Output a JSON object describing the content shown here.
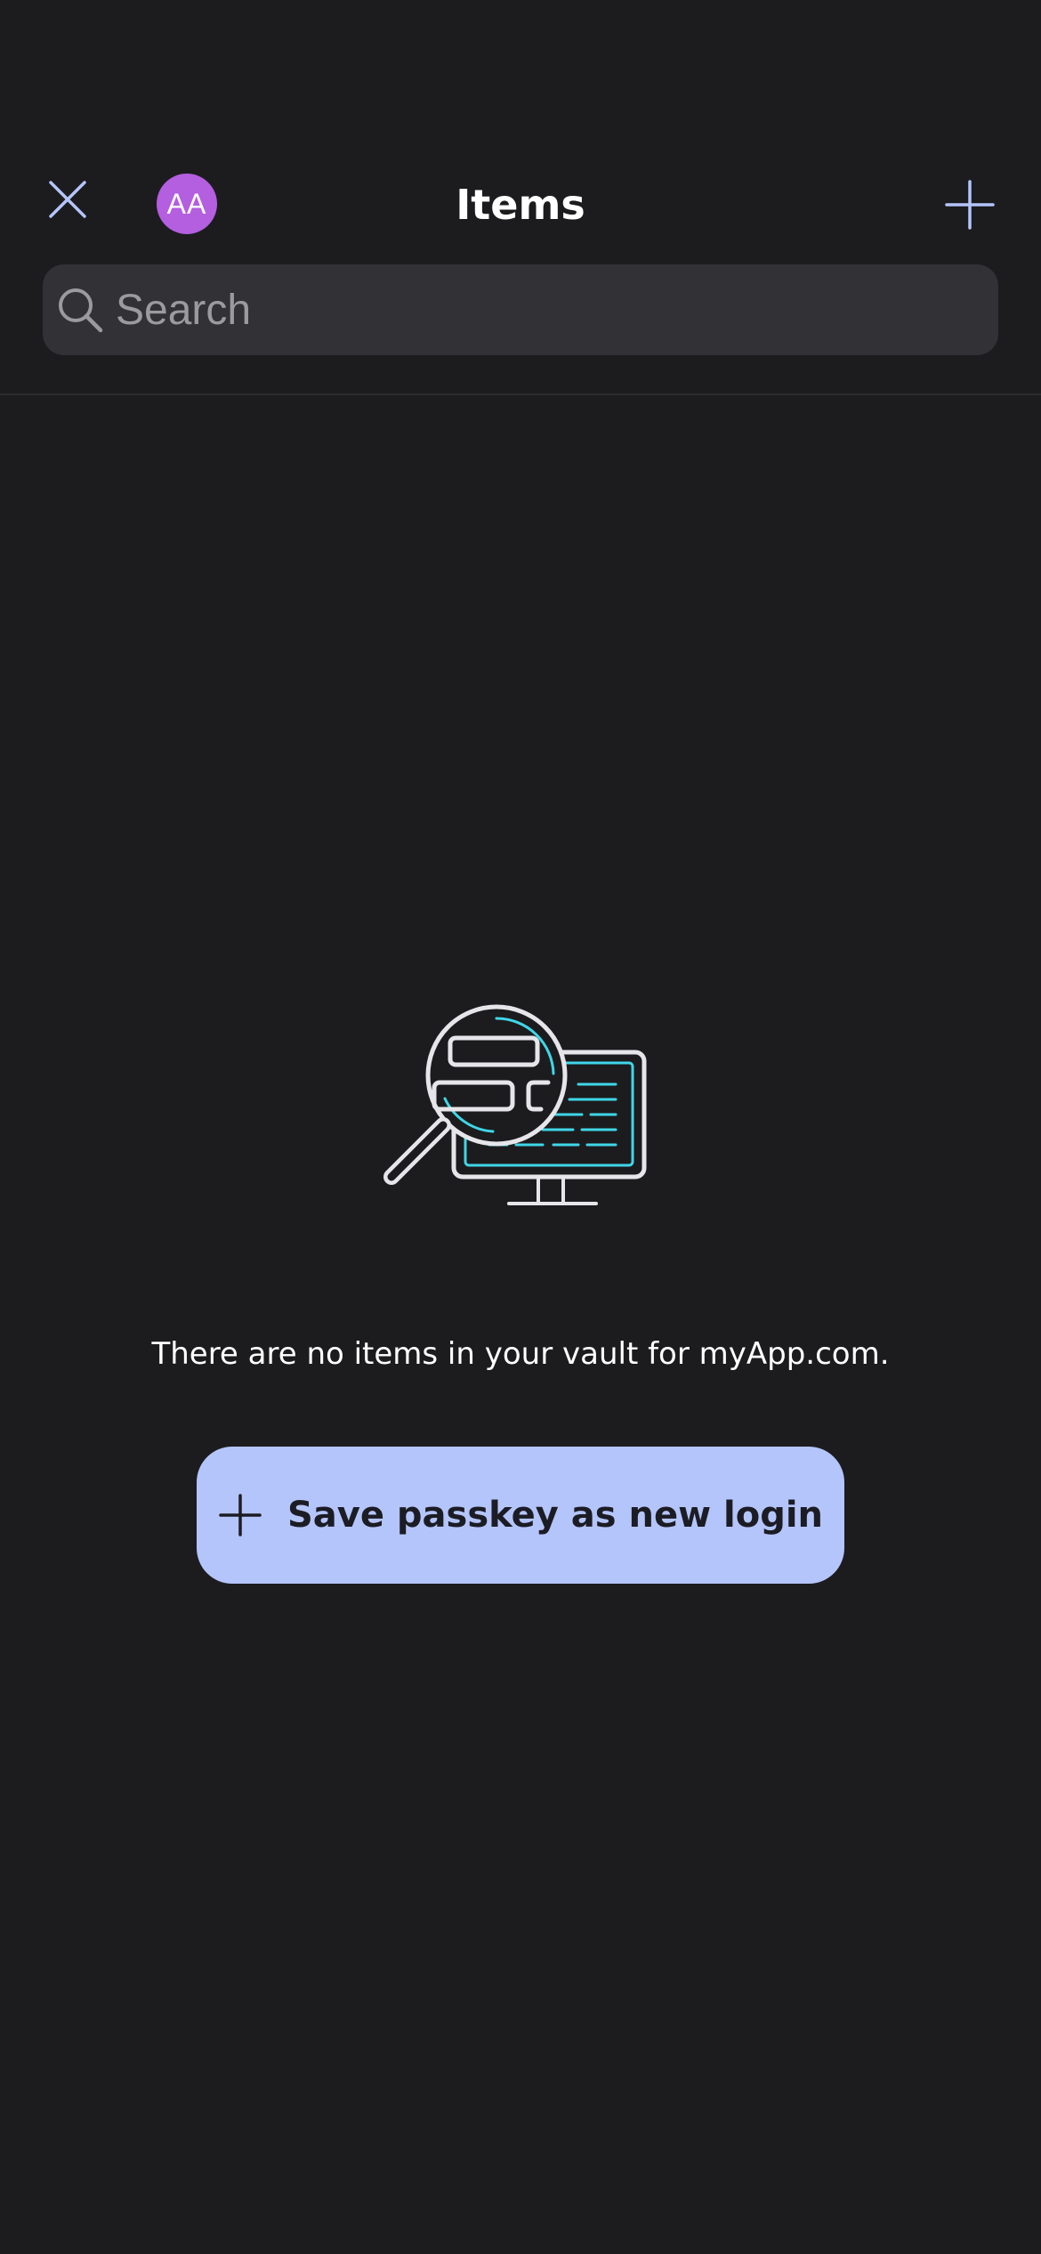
{
  "header": {
    "title": "Items",
    "close_icon": "close-icon",
    "add_icon": "plus-icon",
    "avatar_initials": "AA",
    "avatar_color": "#b45ee0"
  },
  "search": {
    "placeholder": "Search",
    "value": "",
    "icon": "search-icon"
  },
  "empty_state": {
    "illustration": "magnifier-over-monitor-illustration",
    "message": "There are no items in your vault for myApp.com."
  },
  "actions": {
    "save_passkey_label": "Save passkey as new login",
    "save_passkey_icon": "plus-icon"
  },
  "colors": {
    "background": "#1c1c1e",
    "accent": "#b4c5fb",
    "illustration_accent": "#3fd6e8"
  }
}
